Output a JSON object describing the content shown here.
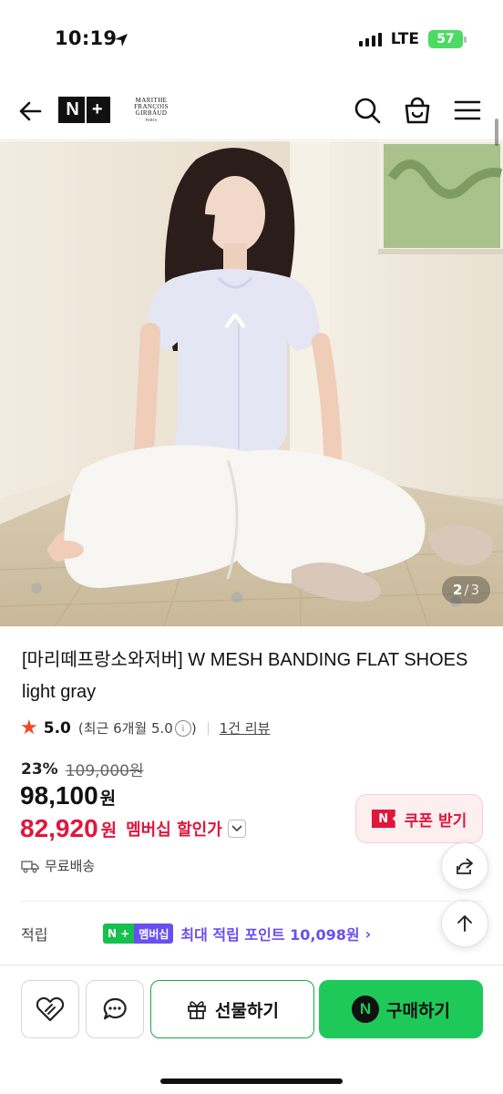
{
  "status_bar": {
    "time": "10:19",
    "network": "LTE",
    "battery": "57"
  },
  "header": {
    "logo_text": "N+",
    "brand_lines": [
      "MARITHE",
      "FRANÇOIS",
      "GIRBAUD",
      "PARIS"
    ],
    "icons": [
      "back-arrow-icon",
      "search-icon",
      "cart-bag-icon",
      "menu-icon"
    ]
  },
  "gallery": {
    "current": "2",
    "separator": "/",
    "total": "3"
  },
  "product": {
    "title": "[마리떼프랑소와저버] W MESH BANDING FLAT SHOES light gray",
    "rating_score": "5.0",
    "rating_recent": "(최근 6개월 5.0",
    "review_count": "1건 리뷰",
    "discount_pct": "23%",
    "original_price": "109,000원",
    "sale_price": "98,100",
    "won": "원",
    "member_price": "82,920",
    "member_label": "멤버십 할인가",
    "coupon_label": "쿠폰 받기",
    "coupon_badge": "N",
    "shipping": "무료배송",
    "points_label": "적립",
    "points_badge_left": "N + ",
    "points_badge_right": "멤버십",
    "points_text": "최대 적립 포인트 10,098원",
    "points_chevron": "›"
  },
  "bottom_bar": {
    "gift_label": "선물하기",
    "buy_label": "구매하기",
    "buy_badge": "N"
  },
  "colors": {
    "accent_red": "#e0163b",
    "naver_green": "#1ec95a",
    "membership_purple": "#6a4ff0",
    "star_orange": "#f04a23"
  }
}
